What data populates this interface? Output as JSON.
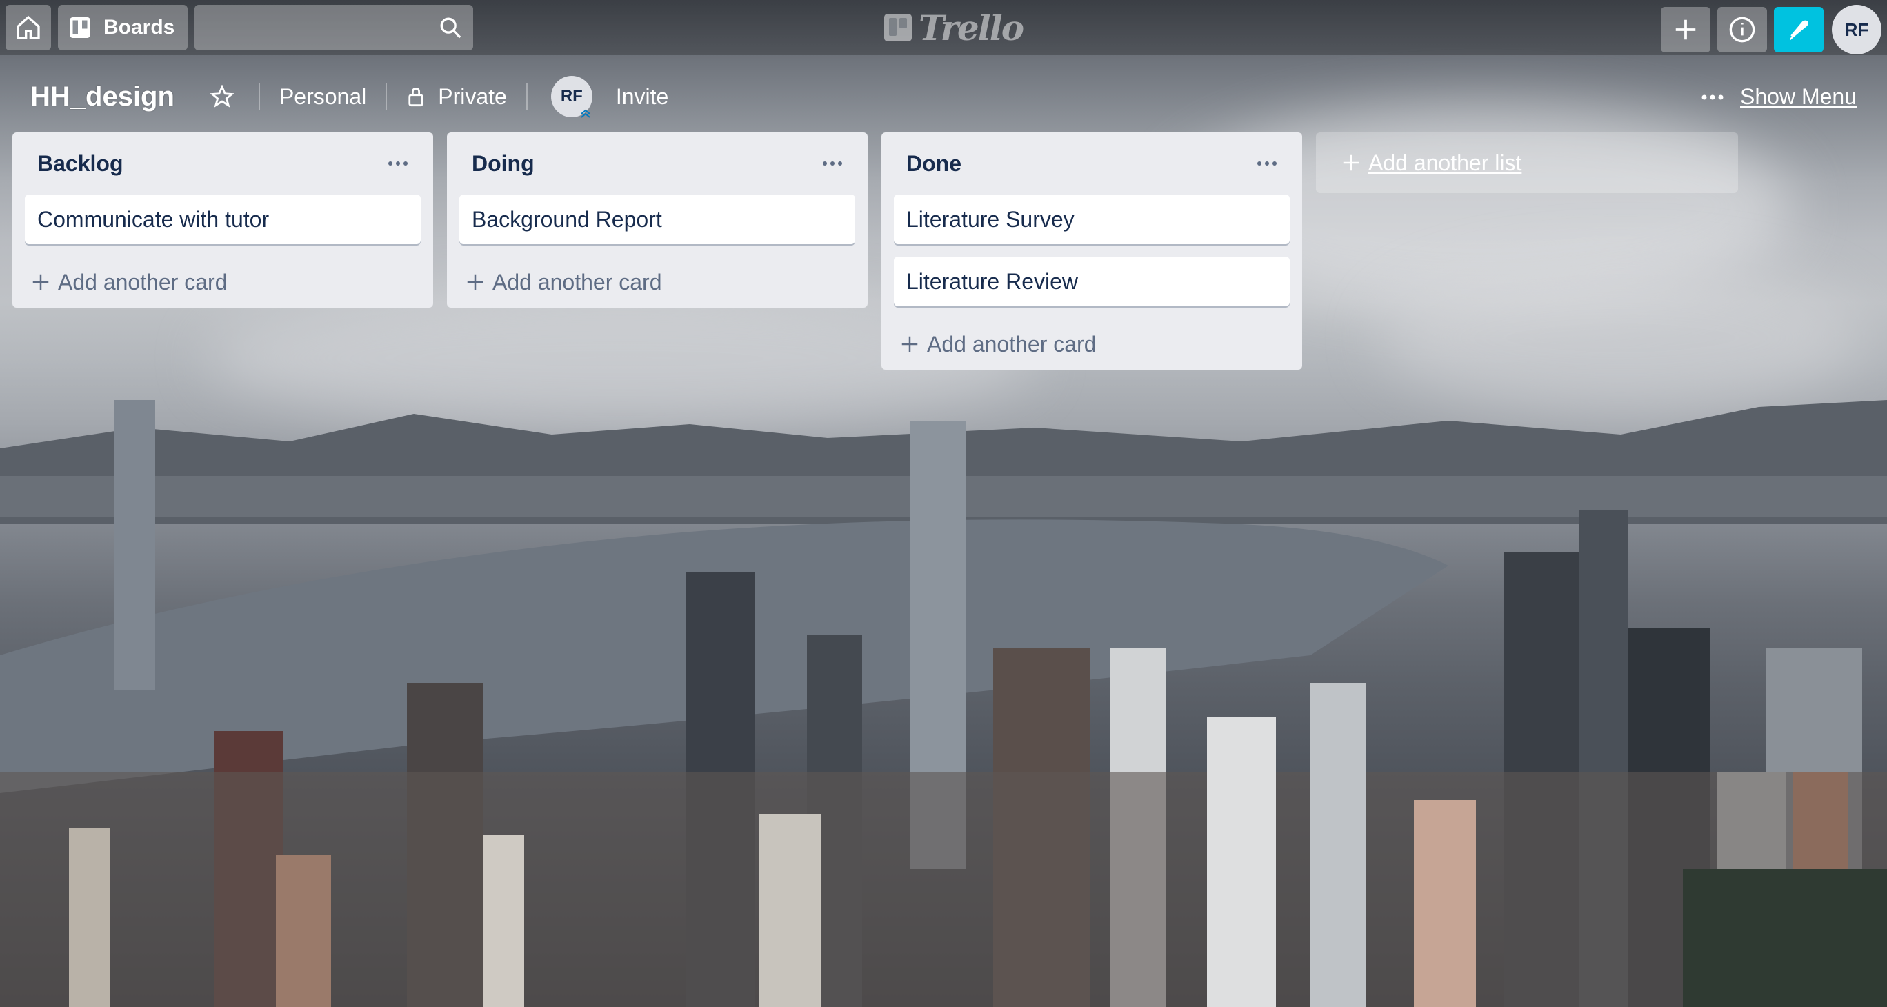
{
  "header": {
    "boards_label": "Boards",
    "search_placeholder": "",
    "logo_text": "Trello",
    "user_initials": "RF"
  },
  "board": {
    "title": "HH_design",
    "visibility_team": "Personal",
    "visibility_privacy": "Private",
    "member_initials": "RF",
    "invite_label": "Invite",
    "show_menu_label": "Show Menu"
  },
  "lists": [
    {
      "title": "Backlog",
      "cards": [
        "Communicate with tutor"
      ],
      "add_card_label": "Add another card"
    },
    {
      "title": "Doing",
      "cards": [
        "Background Report"
      ],
      "add_card_label": "Add another card"
    },
    {
      "title": "Done",
      "cards": [
        "Literature Survey",
        "Literature Review"
      ],
      "add_card_label": "Add another card"
    }
  ],
  "add_list_label": "Add another list",
  "colors": {
    "header_overlay": "rgba(0,0,0,0.24)",
    "list_bg": "#ebecf0",
    "card_text": "#172b4d",
    "muted_text": "#5e6c84",
    "accent_cyan": "#00c2e0"
  },
  "icons": {
    "home": "home-icon",
    "boards": "boards-icon",
    "search": "search-icon",
    "plus": "plus-icon",
    "info": "info-icon",
    "notification": "notification-icon",
    "star": "star-icon",
    "lock": "lock-icon",
    "more": "more-icon"
  }
}
